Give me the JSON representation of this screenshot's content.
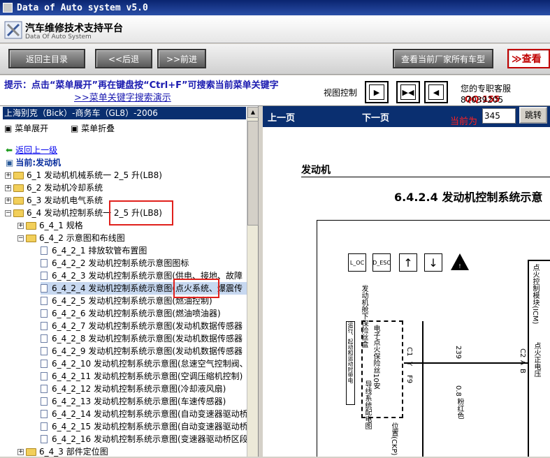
{
  "window": {
    "title": "Data of Auto system v5.0"
  },
  "header": {
    "title": "汽车维修技术支持平台",
    "subtitle": "Data Of Auto System"
  },
  "toolbar": {
    "back_main": "返回主目录",
    "prev": "<<后退",
    "next": ">>前进",
    "view_all_models": "查看当前厂家所有车型",
    "view_partial": "≫查看"
  },
  "hint": {
    "line1": "提示：点击“菜单展开”再在键盘按“Ctrl+F”可搜索当前菜单关键字",
    "line2": ">>菜单关键字搜索演示"
  },
  "view_control": {
    "label": "视图控制"
  },
  "support": {
    "label": "您的专职客服",
    "qq": "QQ:155",
    "phone": "87039205"
  },
  "sidebar": {
    "car": "上海别克（Bick）-商务车（GL8）-2006",
    "expand_menu": "菜单展开",
    "collapse_menu": "菜单折叠",
    "back_link": "返回上一级",
    "current": "当前:发动机",
    "items": [
      "6_1 发动机机械系统一 2_5 升(LB8)",
      "6_2 发动机冷却系统",
      "6_3 发动机电气系统",
      "6_4 发动机控制系统一 2_5 升(LB8)",
      "6_4_1 规格",
      "6_4_2 示意图和布线图",
      "6_4_2_1 排放软管布置图",
      "6_4_2_2 发动机控制系统示意图图标",
      "6_4_2_3 发动机控制系统示意图(供电、接地、故障",
      "6_4_2_4 发动机控制系统示意图(点火系统、爆震传",
      "6_4_2_5 发动机控制系统示意图(燃油控制)",
      "6_4_2_6 发动机控制系统示意图(燃油喷油器)",
      "6_4_2_7 发动机控制系统示意图(发动机数据传感器",
      "6_4_2_8 发动机控制系统示意图(发动机数据传感器",
      "6_4_2_9 发动机控制系统示意图(发动机数据传感器",
      "6_4_2_10 发动机控制系统示意图(怠速空气控制阀、",
      "6_4_2_11 发动机控制系统示意图(空调压缩机控制)",
      "6_4_2_12 发动机控制系统示意图(冷却液风扇)",
      "6_4_2_13 发动机控制系统示意图(车速传感器)",
      "6_4_2_14 发动机控制系统示意图(自动变速器驱动桥",
      "6_4_2_15 发动机控制系统示意图(自动变速器驱动桥",
      "6_4_2_16 发动机控制系统示意图(变速器驱动桥区段",
      "6_4_3 部件定位图"
    ]
  },
  "pager": {
    "prev": "上一页",
    "next": "下一页",
    "current_label": "当前为",
    "page": "345",
    "go": "跳转"
  },
  "document": {
    "heading": "发动机",
    "title": "6.4.2.4 发动机控制系统示意",
    "labels": {
      "fuse_block": "发动机舱下保险丝盒",
      "ignition_module": "点火控制模块(ICM)",
      "fuse": "电子点火保险丝10安",
      "relay_note": "运行、起动和运动时带电",
      "wiring": "导线系统配电图",
      "pin_f9": "F9",
      "pin_c1": "C1",
      "pin_y": "Y",
      "wire_239": "239",
      "pin_b": "B",
      "pin_a": "A",
      "pin_c2": "C2",
      "ign_voltage": "点火正电压",
      "wire_gauge": "0.8",
      "wire_color": "粉红色",
      "ckp": "位置(CKP)",
      "icon1": "L_OC",
      "icon2": "D_ESC"
    }
  }
}
